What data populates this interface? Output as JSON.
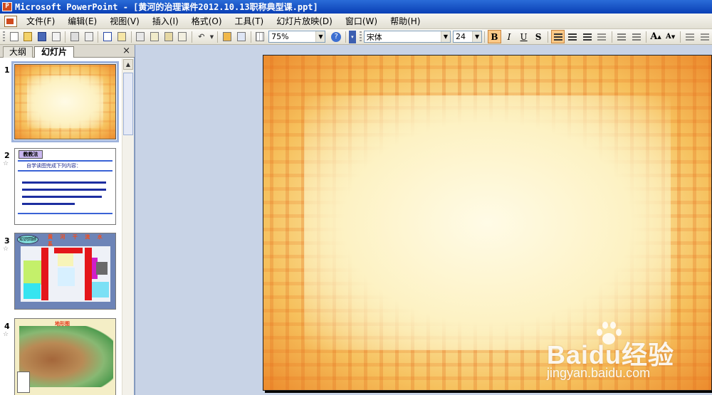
{
  "window": {
    "title": "Microsoft PowerPoint - [黄河的治理课件2012.10.13职称典型课.ppt]"
  },
  "menubar": {
    "items": [
      {
        "label": "文件(F)"
      },
      {
        "label": "编辑(E)"
      },
      {
        "label": "视图(V)"
      },
      {
        "label": "插入(I)"
      },
      {
        "label": "格式(O)"
      },
      {
        "label": "工具(T)"
      },
      {
        "label": "幻灯片放映(D)"
      },
      {
        "label": "窗口(W)"
      },
      {
        "label": "帮助(H)"
      }
    ]
  },
  "toolbar": {
    "zoom": "75%",
    "font_name": "宋体",
    "font_size": "24",
    "bold": "B",
    "italic": "I",
    "underline": "U",
    "shadow": "S",
    "grow_font": "A",
    "shrink_font": "A"
  },
  "leftpanel": {
    "tabs": [
      {
        "label": "大纲"
      },
      {
        "label": "幻灯片"
      }
    ],
    "close": "×",
    "slides": [
      {
        "number": "1"
      },
      {
        "number": "2",
        "tag": "教教法",
        "heading": "自学读图完成下列内容："
      },
      {
        "number": "3",
        "bubble": "知识回顾",
        "header": "黄 河 干 流 水 系"
      },
      {
        "number": "4",
        "title": "地形图"
      }
    ]
  },
  "watermark": {
    "logo": "Baidu经验",
    "url": "jingyan.baidu.com"
  },
  "colors": {
    "titlebar": "#0a3fb5",
    "menubar": "#ece9d8",
    "workspace": "#c8d3e6",
    "slide_center": "#fff6cf",
    "slide_edge": "#ec8a2c"
  }
}
